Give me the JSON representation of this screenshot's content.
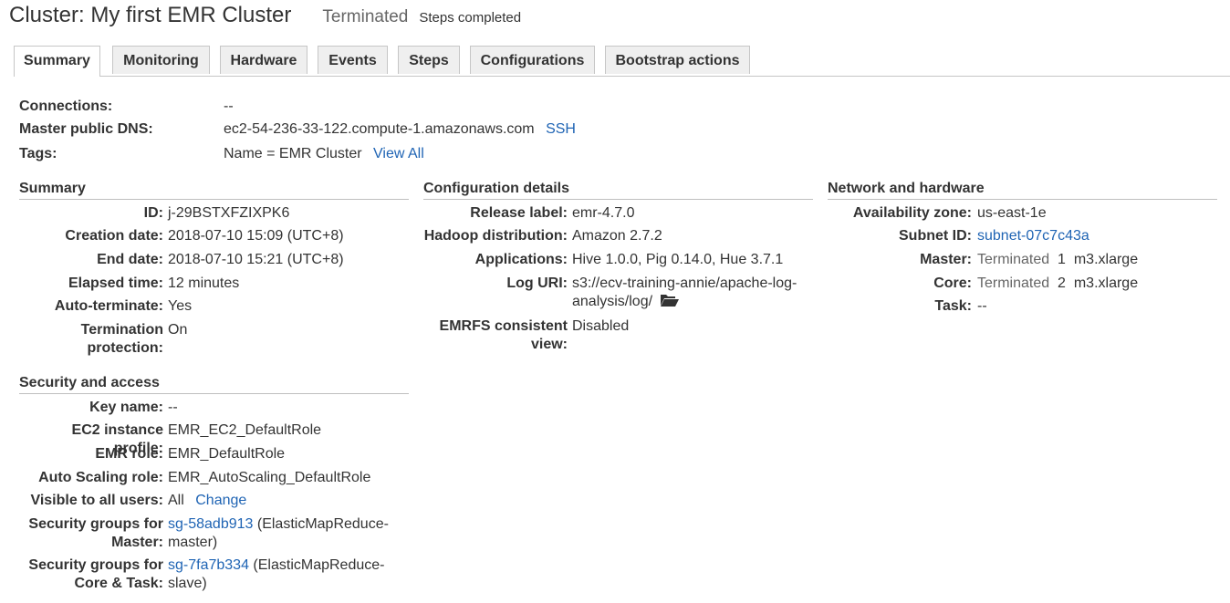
{
  "header": {
    "title": "Cluster: My first EMR Cluster",
    "state": "Terminated",
    "substate": "Steps completed"
  },
  "tabs": [
    {
      "label": "Summary",
      "active": true
    },
    {
      "label": "Monitoring"
    },
    {
      "label": "Hardware"
    },
    {
      "label": "Events"
    },
    {
      "label": "Steps"
    },
    {
      "label": "Configurations"
    },
    {
      "label": "Bootstrap actions"
    }
  ],
  "connections": {
    "connections_label": "Connections:",
    "connections_value": "--",
    "dns_label": "Master public DNS:",
    "dns_value": "ec2-54-236-33-122.compute-1.amazonaws.com",
    "ssh_link": "SSH",
    "tags_label": "Tags:",
    "tags_value": "Name = EMR Cluster",
    "view_all_link": "View All"
  },
  "summary": {
    "title": "Summary",
    "id_label": "ID:",
    "id_value": "j-29BSTXFZIXPK6",
    "creation_label": "Creation date:",
    "creation_value": "2018-07-10 15:09 (UTC+8)",
    "end_label": "End date:",
    "end_value": "2018-07-10 15:21 (UTC+8)",
    "elapsed_label": "Elapsed time:",
    "elapsed_value": "12 minutes",
    "autoterm_label": "Auto-terminate:",
    "autoterm_value": "Yes",
    "termprot_label_1": "Termination",
    "termprot_label_2": "protection:",
    "termprot_value": "On"
  },
  "security": {
    "title": "Security and access",
    "key_label": "Key name:",
    "key_value": "--",
    "ec2_label": "EC2 instance profile:",
    "ec2_value": "EMR_EC2_DefaultRole",
    "emr_label": "EMR role:",
    "emr_value": "EMR_DefaultRole",
    "as_label": "Auto Scaling role:",
    "as_value": "EMR_AutoScaling_DefaultRole",
    "visible_label": "Visible to all users:",
    "visible_value": "All",
    "change_link": "Change",
    "sgm_label_1": "Security groups for",
    "sgm_label_2": "Master:",
    "sgm_link": "sg-58adb913",
    "sgm_value_1": "(ElasticMapReduce-",
    "sgm_value_2": "master)",
    "sgc_label_1": "Security groups for",
    "sgc_label_2": "Core & Task:",
    "sgc_link": "sg-7fa7b334",
    "sgc_value_1": "(ElasticMapReduce-",
    "sgc_value_2": "slave)"
  },
  "config": {
    "title": "Configuration details",
    "release_label": "Release label:",
    "release_value": "emr-4.7.0",
    "hadoop_label": "Hadoop distribution:",
    "hadoop_value": "Amazon 2.7.2",
    "apps_label": "Applications:",
    "apps_value": "Hive 1.0.0, Pig 0.14.0, Hue 3.7.1",
    "log_label": "Log URI:",
    "log_value_1": "s3://ecv-training-annie/apache-log-",
    "log_value_2": "analysis/log/",
    "emrfs_label_1": "EMRFS consistent",
    "emrfs_label_2": "view:",
    "emrfs_value": "Disabled"
  },
  "network": {
    "title": "Network and hardware",
    "az_label": "Availability zone:",
    "az_value": "us-east-1e",
    "subnet_label": "Subnet ID:",
    "subnet_link": "subnet-07c7c43a",
    "master_label": "Master:",
    "master_state": "Terminated",
    "master_count": "1",
    "master_type": "m3.xlarge",
    "core_label": "Core:",
    "core_state": "Terminated",
    "core_count": "2",
    "core_type": "m3.xlarge",
    "task_label": "Task:",
    "task_value": "--"
  }
}
